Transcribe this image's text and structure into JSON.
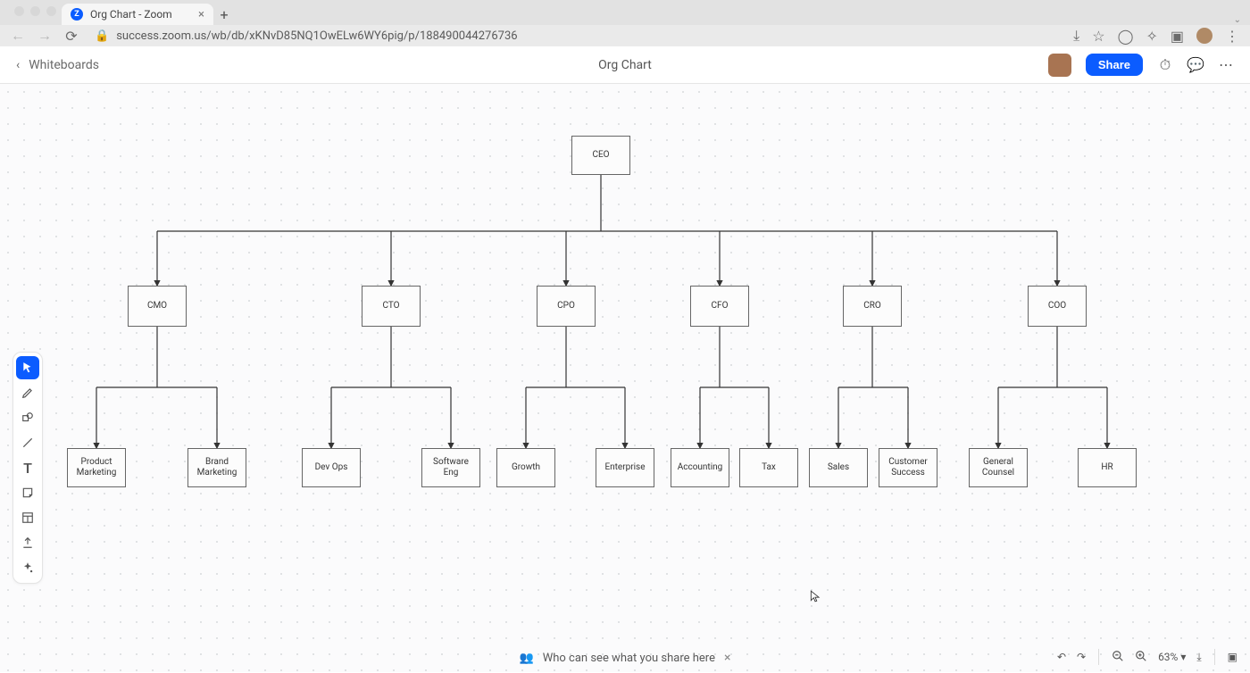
{
  "browser": {
    "tab_title": "Org Chart - Zoom",
    "url": "success.zoom.us/wb/db/xKNvD85NQ1OwELw6WY6pig/p/188490044276736"
  },
  "appbar": {
    "back_label": "Whiteboards",
    "title": "Org Chart",
    "share_label": "Share"
  },
  "toolbar": {
    "tools": [
      "select",
      "pen",
      "shapes",
      "line",
      "text",
      "sticky",
      "template",
      "upload",
      "ai"
    ]
  },
  "org": {
    "root": "CEO",
    "level2": [
      "CMO",
      "CTO",
      "CPO",
      "CFO",
      "CRO",
      "COO"
    ],
    "level3": {
      "CMO": [
        "Product Marketing",
        "Brand Marketing"
      ],
      "CTO": [
        "Dev Ops",
        "Software Eng"
      ],
      "CPO": [
        "Growth",
        "Enterprise"
      ],
      "CFO": [
        "Accounting",
        "Tax"
      ],
      "CRO": [
        "Sales",
        "Customer Success"
      ],
      "COO": [
        "General Counsel",
        "HR"
      ]
    }
  },
  "footer": {
    "prompt": "Who can see what you share here",
    "zoom_label": "63%"
  }
}
